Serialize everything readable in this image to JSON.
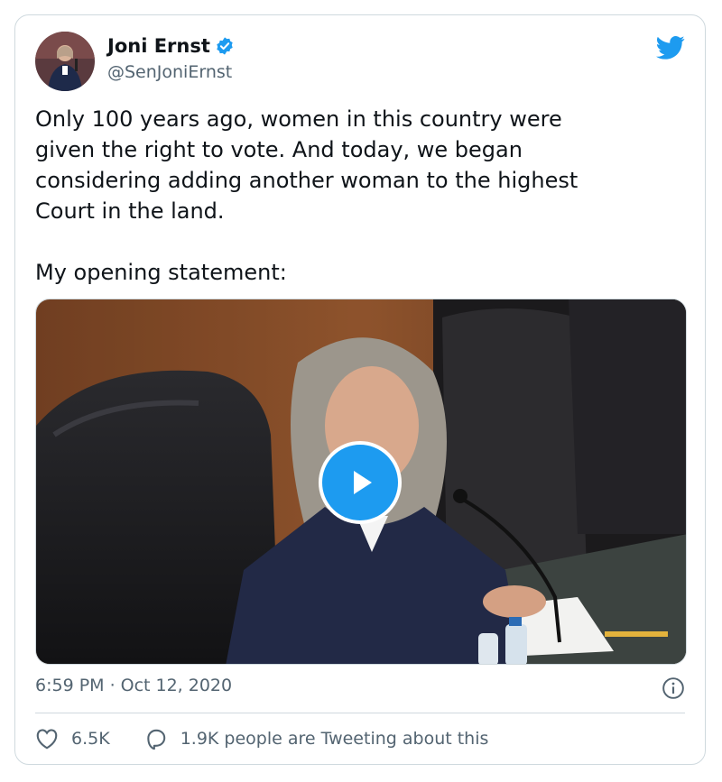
{
  "author": {
    "name": "Joni Ernst",
    "handle": "@SenJoniErnst"
  },
  "tweet": {
    "text": "Only 100 years ago, women in this country were\ngiven the right to vote. And today, we began\nconsidering adding another woman to the highest\nCourt in the land.\n\nMy opening statement:"
  },
  "meta": {
    "time": "6:59 PM",
    "separator": "·",
    "date": "Oct 12, 2020"
  },
  "actions": {
    "likes": "6.5K",
    "conversation": "1.9K people are Tweeting about this"
  },
  "icons": {
    "logo": "twitter-bird-icon",
    "verified": "verified-badge-icon",
    "play": "play-icon",
    "info": "info-icon",
    "like": "heart-icon",
    "reply": "speech-bubble-icon"
  },
  "colors": {
    "brand": "#1d9bf0",
    "text": "#0f1419",
    "secondary": "#536471",
    "border": "#cfd9de"
  }
}
